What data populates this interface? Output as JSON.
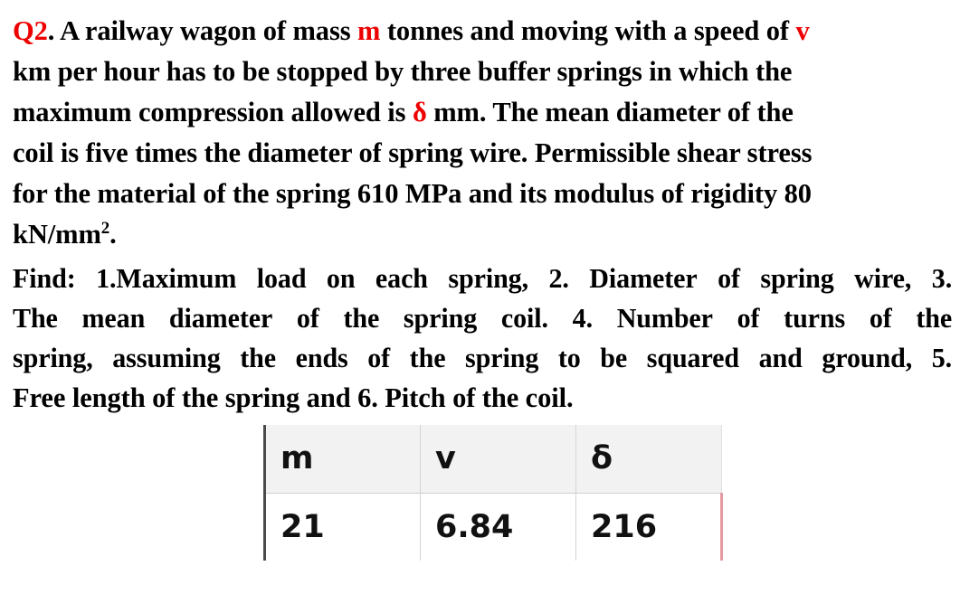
{
  "question": {
    "label": "Q2",
    "label_suffix": ".",
    "accent_color": "#ee0000",
    "paragraph1": {
      "lines": [
        {
          "parts": [
            {
              "text": "Q2",
              "color": "red"
            },
            {
              "text": ". A railway wagon of mass ",
              "color": "black"
            },
            {
              "text": "m",
              "color": "red"
            },
            {
              "text": " tonnes and moving with a speed of ",
              "color": "black"
            },
            {
              "text": "v",
              "color": "red"
            }
          ]
        },
        {
          "parts": [
            {
              "text": "km per hour has to be stopped by three buffer springs in which the",
              "color": "black"
            }
          ]
        },
        {
          "parts": [
            {
              "text": "maximum compression allowed is ",
              "color": "black"
            },
            {
              "text": "δ",
              "color": "red"
            },
            {
              "text": "  mm. The mean diameter of the",
              "color": "black"
            }
          ]
        },
        {
          "parts": [
            {
              "text": "coil is five times the diameter of spring wire. Permissible shear stress",
              "color": "black"
            }
          ]
        },
        {
          "parts": [
            {
              "text": "for the material of the spring 610 MPa and its modulus of rigidity 80",
              "color": "black"
            }
          ]
        },
        {
          "parts": [
            {
              "text": "kN/mm",
              "color": "black"
            },
            {
              "text": "2",
              "color": "black",
              "superscript": true
            },
            {
              "text": ".",
              "color": "black"
            }
          ]
        }
      ],
      "plain_text": "Q2. A railway wagon of mass m tonnes and moving with a speed of v km per hour has to be stopped by three buffer springs in which the maximum compression allowed is δ mm. The mean diameter of the coil is five times the diameter of spring wire. Permissible shear stress for the material of the spring 610 MPa and its modulus of rigidity 80 kN/mm2."
    },
    "paragraph2": {
      "lines": [
        {
          "words": [
            "Find:",
            "1.Maximum",
            "load",
            "on",
            "each",
            "spring,",
            "2.",
            "Diameter",
            "of",
            "spring",
            "wire,",
            "3."
          ]
        },
        {
          "words": [
            "The",
            "mean",
            "diameter",
            "of",
            "the",
            "spring",
            "coil.",
            "4.",
            "Number",
            "of",
            "turns",
            "of",
            "the"
          ]
        },
        {
          "words": [
            "spring,",
            "assuming",
            "the",
            "ends",
            "of",
            "the",
            "spring",
            "to",
            "be",
            "squared",
            "and",
            "ground,",
            "5."
          ]
        },
        {
          "words": [
            "Free",
            "length",
            "of",
            "the",
            "spring",
            "and",
            "6.",
            "Pitch",
            "of",
            "the",
            "coil."
          ],
          "last": true
        }
      ],
      "plain_text": "Find: 1.Maximum load on each spring, 2. Diameter of spring wire, 3. The mean diameter of the spring coil. 4. Number of turns of the spring, assuming the ends of the spring to be squared and ground, 5. Free length of the spring and 6. Pitch of the coil."
    },
    "given_values": {
      "mass_tonnes": "21",
      "speed_kmph": "6.84",
      "compression_mm": "216",
      "shear_stress_mpa": "610",
      "modulus_rigidity": "80"
    }
  },
  "table": {
    "headers": [
      "m",
      "v",
      "δ"
    ],
    "rows": [
      [
        "21",
        "6.84",
        "216"
      ]
    ],
    "header_bg": "#f2f2f2",
    "row_bg": "#ffffff",
    "left_border_color": "#4a4a4a",
    "right_border_color": "#e79aa0"
  }
}
